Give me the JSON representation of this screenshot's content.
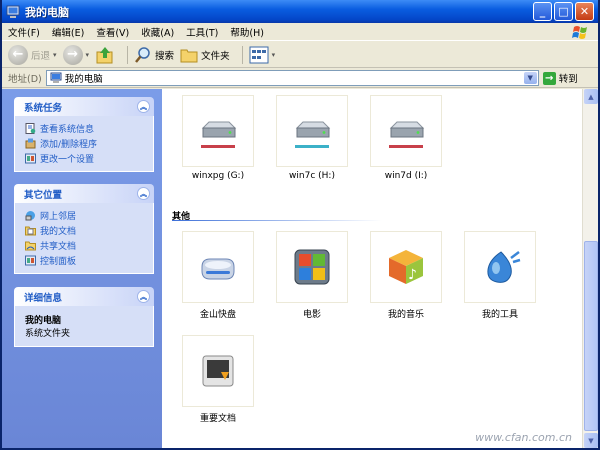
{
  "window": {
    "title": "我的电脑"
  },
  "menubar": {
    "items": [
      "文件(F)",
      "编辑(E)",
      "查看(V)",
      "收藏(A)",
      "工具(T)",
      "帮助(H)"
    ]
  },
  "toolbar": {
    "back_label": "后退",
    "search_label": "搜索",
    "folders_label": "文件夹"
  },
  "addressbar": {
    "label": "地址(D)",
    "value": "我的电脑",
    "go_label": "转到"
  },
  "sidebar": {
    "system_tasks": {
      "title": "系统任务",
      "items": [
        "查看系统信息",
        "添加/删除程序",
        "更改一个设置"
      ]
    },
    "other_places": {
      "title": "其它位置",
      "items": [
        "网上邻居",
        "我的文档",
        "共享文档",
        "控制面板"
      ]
    },
    "details": {
      "title": "详细信息",
      "name": "我的电脑",
      "type": "系统文件夹"
    }
  },
  "drives": [
    {
      "label": "winxpg (G:)",
      "bar_color": "#c8404a"
    },
    {
      "label": "win7c (H:)",
      "bar_color": "#3cb1c8"
    },
    {
      "label": "win7d (I:)",
      "bar_color": "#c8404a"
    }
  ],
  "other_group": {
    "title": "其他",
    "items": [
      "金山快盘",
      "电影",
      "我的音乐",
      "我的工具",
      "重要文档"
    ]
  },
  "watermark": "www.cfan.com.cn"
}
